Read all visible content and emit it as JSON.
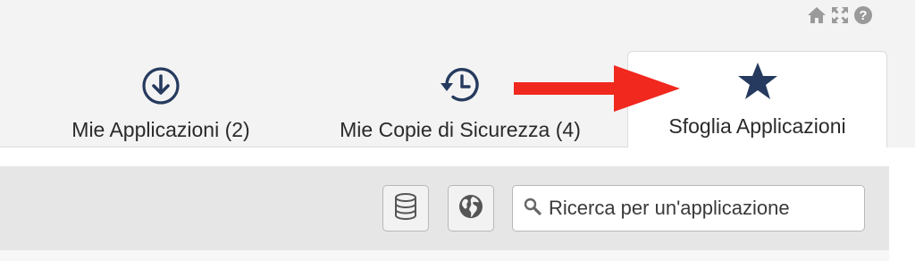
{
  "header_icons": [
    {
      "name": "home-icon"
    },
    {
      "name": "expand-icon"
    },
    {
      "name": "help-icon"
    }
  ],
  "tabs": [
    {
      "id": "my_apps",
      "label": "Mie Applicazioni (2)",
      "icon": "download-circle-icon",
      "active": false
    },
    {
      "id": "backups",
      "label": "Mie Copie di Sicurezza (4)",
      "icon": "history-icon",
      "active": false
    },
    {
      "id": "browse",
      "label": "Sfoglia Applicazioni",
      "icon": "star-icon",
      "active": true
    }
  ],
  "toolbar": {
    "database_button_icon": "database-icon",
    "globe_button_icon": "globe-icon",
    "search": {
      "icon": "search-icon",
      "placeholder": "Ricerca per un'applicazione",
      "value": ""
    }
  },
  "annotation": {
    "icon": "red-arrow-icon",
    "color": "#f0281e"
  },
  "colors": {
    "accent": "#253a5e",
    "icon_gray": "#9a9a9a"
  }
}
